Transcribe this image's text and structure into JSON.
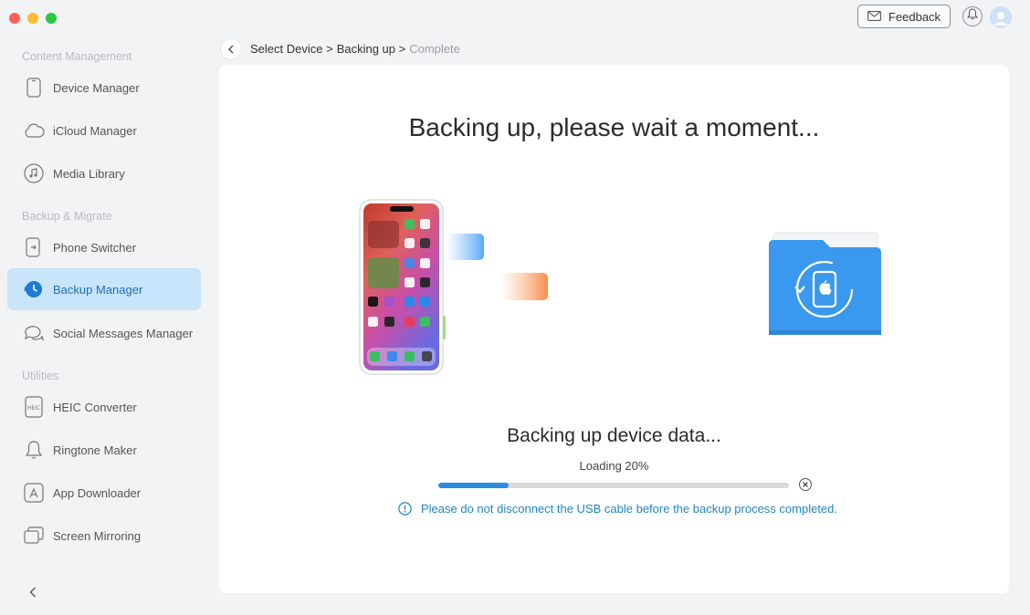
{
  "header": {
    "feedback_label": "Feedback"
  },
  "sidebar": {
    "sections": [
      {
        "title": "Content Management"
      },
      {
        "title": "Backup & Migrate"
      },
      {
        "title": "Utilities"
      }
    ],
    "items": [
      {
        "label": "Device Manager",
        "icon": "phone-icon"
      },
      {
        "label": "iCloud Manager",
        "icon": "cloud-icon"
      },
      {
        "label": "Media Library",
        "icon": "music-icon"
      },
      {
        "label": "Phone Switcher",
        "icon": "phone-switch-icon"
      },
      {
        "label": "Backup Manager",
        "icon": "backup-clock-icon",
        "active": true
      },
      {
        "label": "Social Messages Manager",
        "icon": "chat-bubbles-icon"
      },
      {
        "label": "HEIC Converter",
        "icon": "heic-icon"
      },
      {
        "label": "Ringtone Maker",
        "icon": "bell-icon"
      },
      {
        "label": "App Downloader",
        "icon": "app-store-icon"
      },
      {
        "label": "Screen Mirroring",
        "icon": "screen-mirror-icon"
      }
    ]
  },
  "breadcrumb": {
    "step1": "Select Device >",
    "step2": "Backing up >",
    "step3": "Complete"
  },
  "main": {
    "title": "Backing up, please wait a moment...",
    "status": "Backing up device data...",
    "progress_label": "Loading 20%",
    "progress": 0.2,
    "warning": "Please do not disconnect the USB cable before the backup process completed."
  },
  "colors": {
    "accent": "#2b8de0",
    "active_bg": "#c9e5fb",
    "folder": "#3a98ee"
  }
}
